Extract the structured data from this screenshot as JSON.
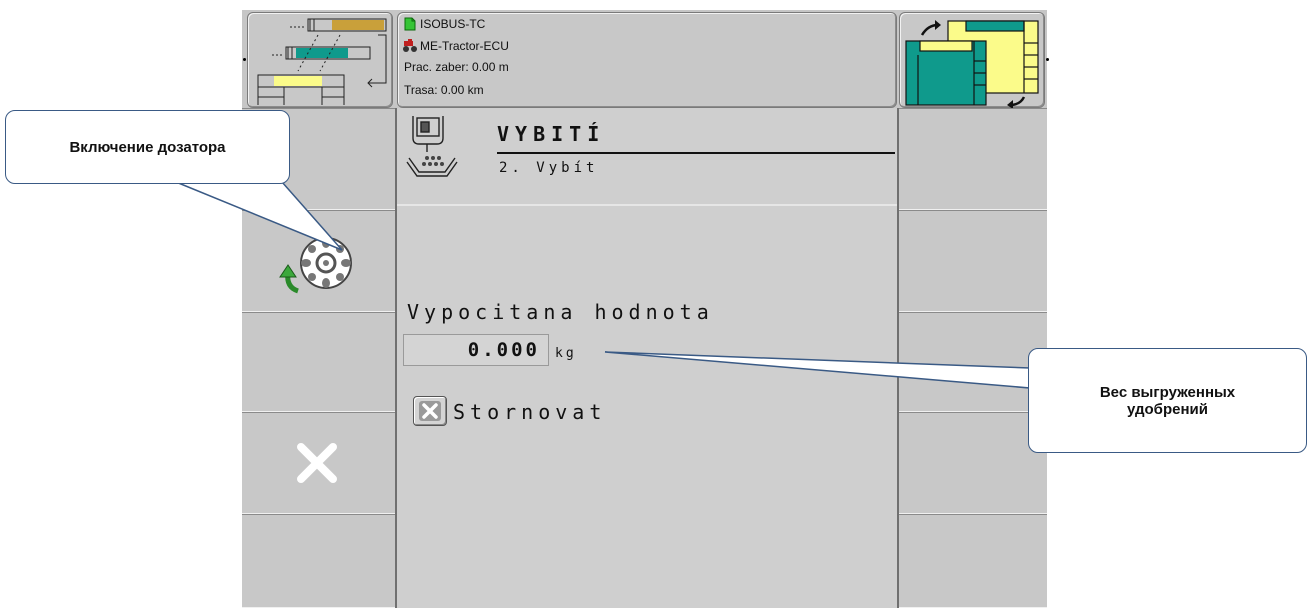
{
  "status_box": {
    "line1": "ISOBUS-TC",
    "line2": "ME-Tractor-ECU",
    "line3": "Prac. zaber: 0.00  m",
    "line4": "Trasa: 0.00  km"
  },
  "screen": {
    "title": "VYBITÍ",
    "subtitle": "2. Vybít"
  },
  "value_field": {
    "label": "Vypocitana hodnota",
    "value": "0.000",
    "unit": "kg"
  },
  "cancel": {
    "label": "Stornovat"
  },
  "callouts": {
    "left": "Включение дозатора",
    "right": "Вес выгруженных удобрений"
  },
  "colors": {
    "terminal_bg": "#c6c6c6",
    "teal": "#0f9a8c",
    "yellow": "#fbfb8a",
    "gold": "#c9a03a",
    "callout_border": "#3a5a85"
  },
  "icons": {
    "left_top": "field-sections-icon",
    "right_top": "swap-pages-icon",
    "doser": "metering-wheel-icon",
    "screen": "unload-hopper-icon",
    "cancel": "x-icon",
    "status_file": "file-icon",
    "status_tractor": "tractor-icon"
  }
}
